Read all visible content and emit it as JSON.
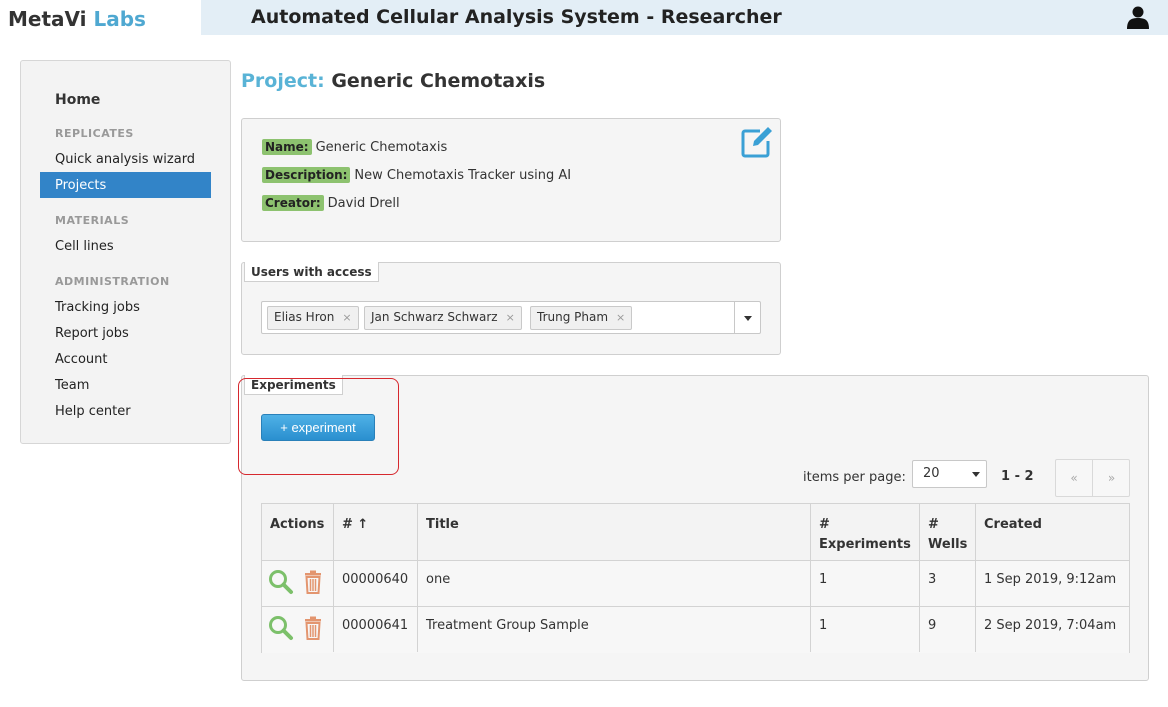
{
  "header": {
    "brand_part1": "MetaVi",
    "brand_part2": "Labs",
    "app_title": "Automated Cellular Analysis System - Researcher",
    "user_icon": "user-icon"
  },
  "sidebar": {
    "home": "Home",
    "sections": {
      "replicates": "REPLICATES",
      "materials": "MATERIALS",
      "administration": "ADMINISTRATION"
    },
    "items": {
      "quick_analysis": "Quick analysis wizard",
      "projects": "Projects",
      "cell_lines": "Cell lines",
      "tracking_jobs": "Tracking jobs",
      "report_jobs": "Report jobs",
      "account": "Account",
      "team": "Team",
      "help_center": "Help center"
    },
    "active_item": "Projects"
  },
  "project": {
    "title_label": "Project:",
    "title_value": "Generic Chemotaxis",
    "fields": {
      "name_label": "Name:",
      "name_value": "Generic Chemotaxis",
      "description_label": "Description:",
      "description_value": "New Chemotaxis Tracker using AI",
      "creator_label": "Creator:",
      "creator_value": "David Drell"
    },
    "edit_icon": "edit-icon"
  },
  "users_access": {
    "legend": "Users with access",
    "users": [
      "Elias Hron",
      "Jan Schwarz Schwarz",
      "Trung Pham"
    ],
    "remove_glyph": "×"
  },
  "experiments": {
    "legend": "Experiments",
    "add_button": "+ experiment",
    "items_per_page_label": "items per page:",
    "items_per_page_value": "20",
    "range": "1 - 2",
    "prev": "«",
    "next": "»",
    "columns": {
      "actions": "Actions",
      "number": "# ↑",
      "title": "Title",
      "experiments_line1": "#",
      "experiments_line2": "Experiments",
      "wells_line1": "#",
      "wells_line2": "Wells",
      "created": "Created"
    },
    "rows": [
      {
        "number": "00000640",
        "title": "one",
        "experiments": "1",
        "wells": "3",
        "created": "1 Sep 2019, 9:12am"
      },
      {
        "number": "00000641",
        "title": "Treatment Group Sample",
        "experiments": "1",
        "wells": "9",
        "created": "2 Sep 2019, 7:04am"
      }
    ]
  },
  "colors": {
    "accent": "#3284c8",
    "title_label": "#59b3d6",
    "tag_green": "#8dc26f",
    "highlight_red": "#d6282e",
    "search_green": "#7cc06a",
    "trash_orange": "#e3956f"
  }
}
